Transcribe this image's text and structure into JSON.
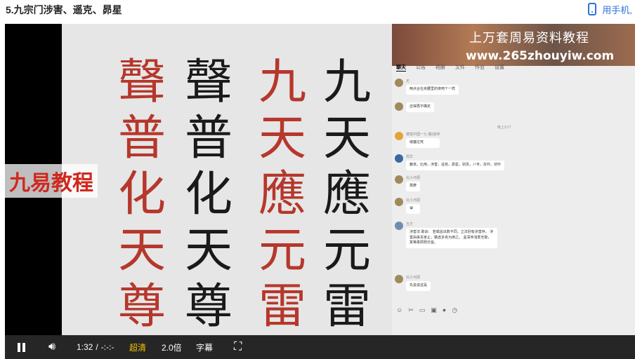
{
  "page": {
    "title": "5.九宗门涉害、遥克、昴星",
    "phone_link": "用手机,"
  },
  "slide": {
    "glyphs": [
      "九",
      "天",
      "應",
      "元",
      "雷",
      "聲",
      "普",
      "化",
      "天",
      "尊"
    ],
    "seal_glyphs": [
      "九",
      "天",
      "應",
      "元",
      "雷",
      "聲",
      "普",
      "化",
      "天",
      "尊"
    ],
    "watermark": "九易教程"
  },
  "chat": {
    "banner_title": "上万套周易资料教程",
    "banner_url": "www.265zhouyiw.com",
    "tabs": [
      "聊天",
      "公告",
      "相册",
      "文件",
      "作业",
      "设置"
    ],
    "timestamp": "晚上9:27",
    "messages": [
      {
        "sender": "无",
        "text": "两点合在夹腰里的夜吧个一样"
      },
      {
        "sender": "",
        "text": "还得再不确定"
      },
      {
        "sender": "德滋中国一七·路(徐仲",
        "text": "缝魔过死"
      },
      {
        "sender": "周华",
        "text": "魅克，比用，涉害，遥克，昴星，别责，八专，反吟，伏吟"
      },
      {
        "sender": "北小河源",
        "text": "蒿摩"
      },
      {
        "sender": "北小河源",
        "text": "😀"
      },
      {
        "sender": "五方",
        "text": "涉害法 歌诀： 若或遥出数不同，立法别有涉害存。 涉害由来本家止，路途多克为用之。 孟深仲浅季无取，复等柔辰刚日宜。"
      },
      {
        "sender": "北小河源",
        "text": "先说说这是"
      }
    ]
  },
  "controls": {
    "time": "1:32",
    "separator": "/",
    "duration": "-:-:-",
    "quality": "超清",
    "speed": "2.0倍",
    "subtitles": "字幕"
  }
}
